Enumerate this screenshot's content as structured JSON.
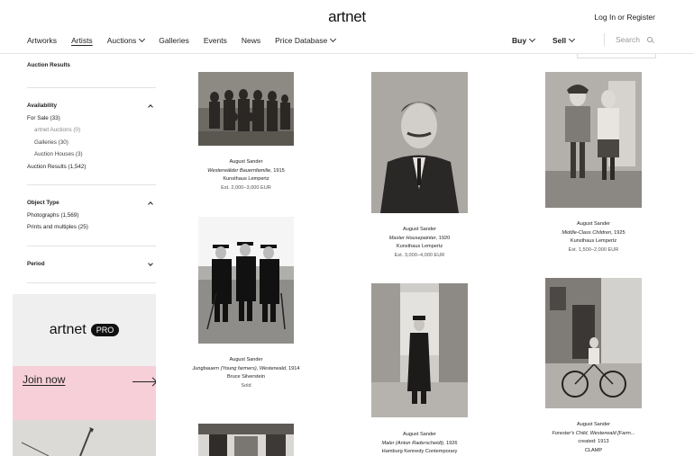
{
  "header": {
    "logo": "artnet",
    "login": "Log In or Register",
    "nav": [
      "Artworks",
      "Artists",
      "Auctions",
      "Galleries",
      "Events",
      "News",
      "Price Database"
    ],
    "buy": "Buy",
    "sell": "Sell",
    "search_placeholder": "Search"
  },
  "sidebar": {
    "auction_results_title": "Auction Results",
    "availability_title": "Availability",
    "availability": {
      "for_sale": "For Sale (33)",
      "artnet_auctions": "artnet Auctions (0)",
      "galleries": "Galleries (30)",
      "auction_houses": "Auction Houses (3)",
      "auction_results": "Auction Results (1,542)"
    },
    "object_type_title": "Object Type",
    "object_types": [
      "Photographs (1,569)",
      "Prints and multiples (25)"
    ],
    "period_title": "Period"
  },
  "ad": {
    "brand": "artnet",
    "pro": "PRO",
    "join": "Join now"
  },
  "artworks": [
    {
      "artist": "August Sander",
      "title": "Westerwälder Bauernfamilie",
      "year": ", 1915",
      "venue": "Kunsthaus Lempertz",
      "price": "Est. 2,000–3,000 EUR"
    },
    {
      "artist": "August Sander",
      "title": "Master Housepainter",
      "year": ", 1920",
      "venue": "Kunsthaus Lempertz",
      "price": "Est. 3,000–4,000 EUR"
    },
    {
      "artist": "August Sander",
      "title": "Middle-Class Children",
      "year": ", 1925",
      "venue": "Kunsthaus Lempertz",
      "price": "Est. 1,500–2,000 EUR"
    },
    {
      "artist": "August Sander",
      "title": "Jungbauern (Young farmers), Westerwald",
      "year": ", 1914",
      "venue": "Bruce Silverstein",
      "price": "Sold"
    },
    {
      "artist": "August Sander",
      "title": "Maler (Anton Raderscheidt)",
      "year": ", 1926",
      "venue": "Hamburg Kennedy Contemporary",
      "price": ""
    },
    {
      "artist": "August Sander",
      "title": "Forester's Child, Westerwald [Farm...",
      "year": "",
      "venue": "created: 1913",
      "price": "CLAMP"
    }
  ]
}
